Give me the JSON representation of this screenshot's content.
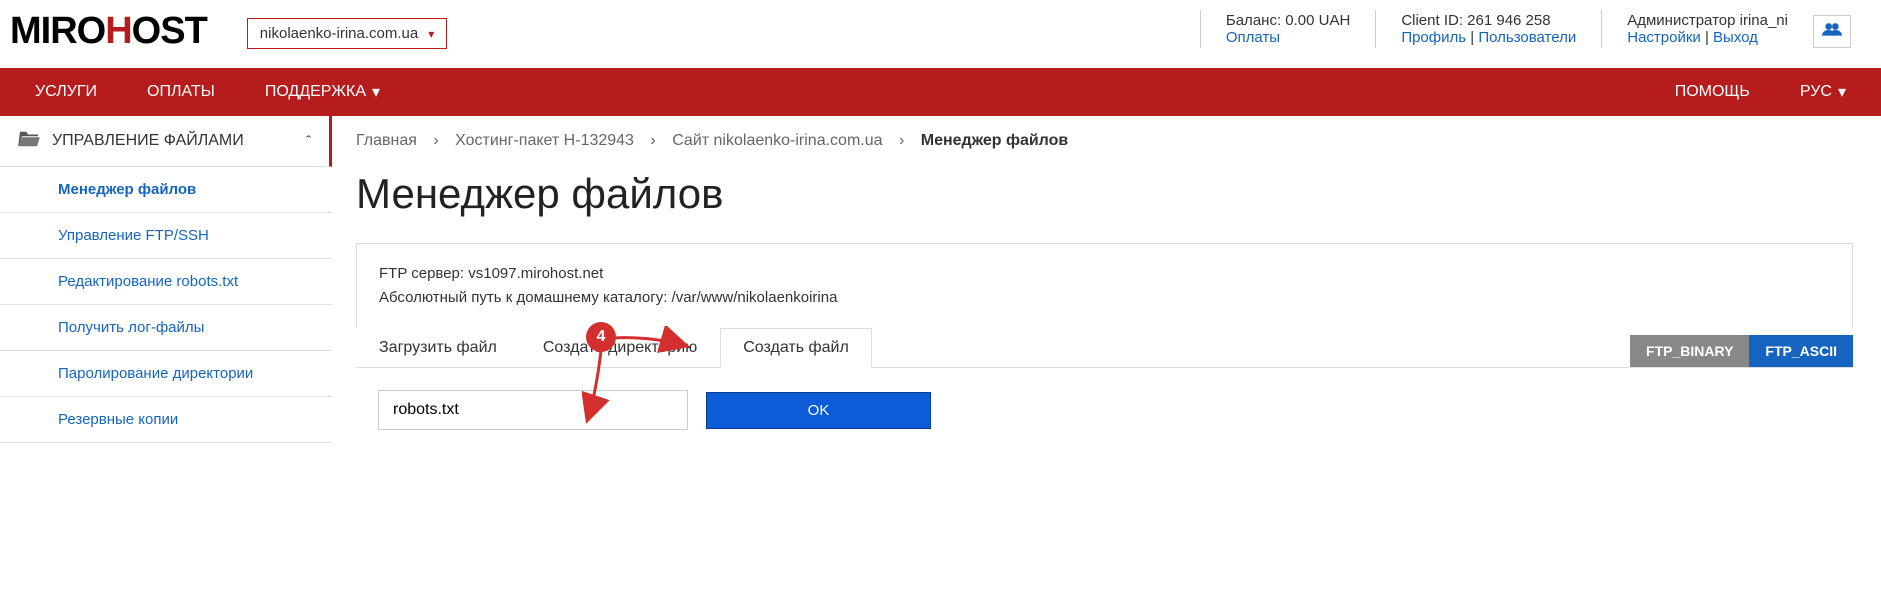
{
  "header": {
    "logo_part1": "MIRO",
    "logo_part2": "H",
    "logo_part3": "OST",
    "domain": "nikolaenko-irina.com.ua",
    "balance_label": "Баланс: 0.00 UAH",
    "payments_link": "Оплаты",
    "client_id_label": "Client ID: 261 946 258",
    "profile_link": "Профиль",
    "users_link": "Пользователи",
    "admin_label": "Администратор irina_ni",
    "settings_link": "Настройки",
    "logout_link": "Выход"
  },
  "nav": {
    "services": "УСЛУГИ",
    "payments": "ОПЛАТЫ",
    "support": "ПОДДЕРЖКА",
    "help": "ПОМОЩЬ",
    "lang": "РУС"
  },
  "sidebar": {
    "title": "УПРАВЛЕНИЕ ФАЙЛАМИ",
    "items": [
      "Менеджер файлов",
      "Управление FTP/SSH",
      "Редактирование robots.txt",
      "Получить лог-файлы",
      "Паролирование директории",
      "Резервные копии"
    ]
  },
  "breadcrumb": {
    "home": "Главная",
    "hosting": "Хостинг-пакет H-132943",
    "site": "Сайт nikolaenko-irina.com.ua",
    "current": "Менеджер файлов"
  },
  "page_title": "Менеджер файлов",
  "info": {
    "ftp_server": "FTP сервер: vs1097.mirohost.net",
    "abs_path": "Абсолютный путь к домашнему каталогу: /var/www/nikolaenkoirina"
  },
  "tabs": {
    "upload": "Загрузить файл",
    "create_dir": "Создать директорию",
    "create_file": "Создать файл"
  },
  "ftp": {
    "binary": "FTP_BINARY",
    "ascii": "FTP_ASCII"
  },
  "form": {
    "filename": "robots.txt",
    "ok": "OK"
  },
  "annotation": {
    "badge": "4"
  }
}
